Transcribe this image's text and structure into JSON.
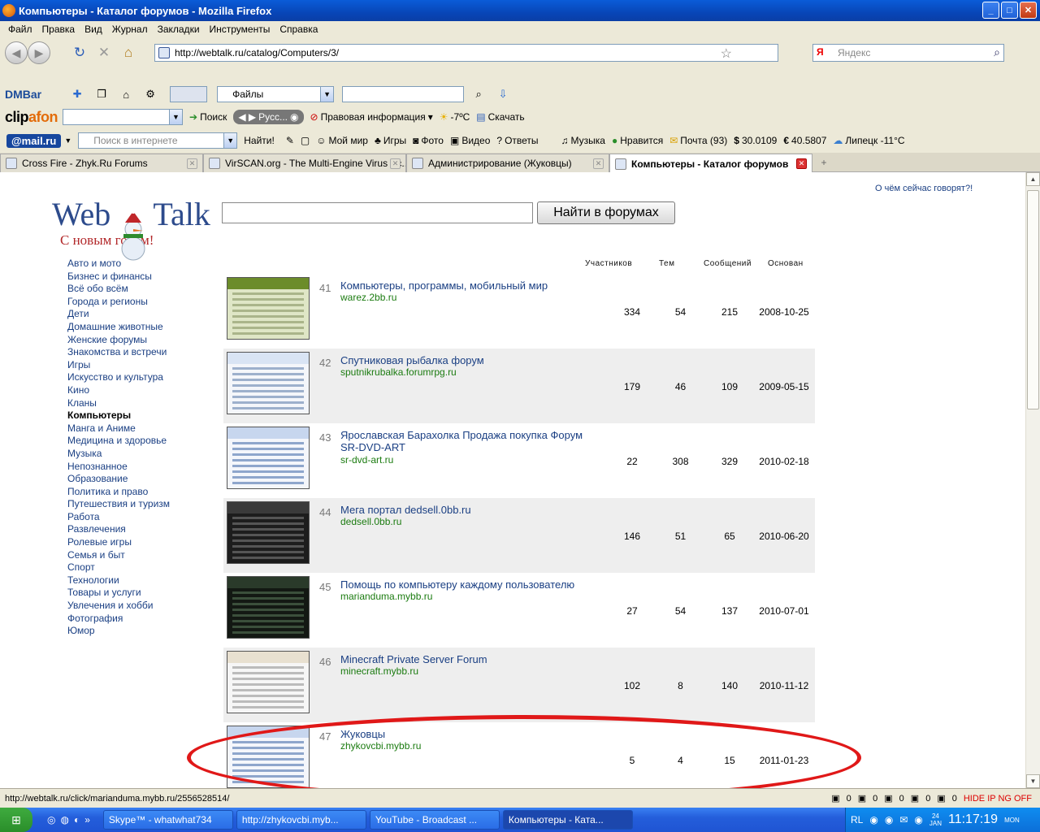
{
  "window": {
    "title": "Компьютеры - Каталог форумов - Mozilla Firefox"
  },
  "menu": [
    "Файл",
    "Правка",
    "Вид",
    "Журнал",
    "Закладки",
    "Инструменты",
    "Справка"
  ],
  "nav": {
    "url": "http://webtalk.ru/catalog/Computers/3/",
    "search_placeholder": "Яндекс",
    "search_engine_letter": "Я"
  },
  "dmbar": {
    "brand": "DMBar",
    "files_select": "Файлы"
  },
  "clipafon": {
    "brand_a": "clip",
    "brand_b": "afon",
    "search": "Поиск",
    "player_text": "Русс...",
    "legal": "Правовая информация",
    "temp": "-7ºC",
    "download": "Скачать"
  },
  "mailbar": {
    "brand": "@mail.ru",
    "search_placeholder": "Поиск в интернете",
    "find": "Найти!",
    "items": [
      "Мой мир",
      "Игры",
      "Фото",
      "Видео",
      "Ответы",
      "Музыка",
      "Нравится",
      "Почта (93)",
      "30.0109",
      "40.5807",
      "Липецк -11°C"
    ],
    "dollar": "$",
    "euro": "€"
  },
  "tabs": [
    {
      "label": "Cross Fire - Zhyk.Ru Forums",
      "active": false
    },
    {
      "label": "VirSCAN.org - The Multi-Engine Virus Sc...",
      "active": false
    },
    {
      "label": "Администрирование (Жуковцы)",
      "active": false
    },
    {
      "label": "Компьютеры - Каталог форумов",
      "active": true
    }
  ],
  "page": {
    "top_link": "О чём сейчас говорят?!",
    "logo_a": "Web",
    "logo_b": "Talk",
    "logo_sub": "С новым годом!",
    "search_button": "Найти в форумах",
    "categories": [
      "Авто и мото",
      "Бизнес и финансы",
      "Всё обо всём",
      "Города и регионы",
      "Дети",
      "Домашние животные",
      "Женские форумы",
      "Знакомства и встречи",
      "Игры",
      "Искусство и культура",
      "Кино",
      "Кланы",
      "Компьютеры",
      "Манга и Аниме",
      "Медицина и здоровье",
      "Музыка",
      "Непознанное",
      "Образование",
      "Политика и право",
      "Путешествия и туризм",
      "Работа",
      "Развлечения",
      "Ролевые игры",
      "Семья и быт",
      "Спорт",
      "Технологии",
      "Товары и услуги",
      "Увлечения и хобби",
      "Фотография",
      "Юмор"
    ],
    "selected_category": "Компьютеры",
    "columns": {
      "members": "Участников",
      "topics": "Тем",
      "messages": "Сообщений",
      "founded": "Основан"
    },
    "forums": [
      {
        "num": "41",
        "title": "Компьютеры, программы, мобильный мир",
        "url": "warez.2bb.ru",
        "members": "334",
        "topics": "54",
        "messages": "215",
        "founded": "2008-10-25"
      },
      {
        "num": "42",
        "title": "Спутниковая рыбалка форум",
        "url": "sputnikrubalka.forumrpg.ru",
        "members": "179",
        "topics": "46",
        "messages": "109",
        "founded": "2009-05-15"
      },
      {
        "num": "43",
        "title": "Ярославская Барахолка Продажа покупка Форум SR-DVD-ART",
        "url": "sr-dvd-art.ru",
        "members": "22",
        "topics": "308",
        "messages": "329",
        "founded": "2010-02-18"
      },
      {
        "num": "44",
        "title": "Мега портал dedsell.0bb.ru",
        "url": "dedsell.0bb.ru",
        "members": "146",
        "topics": "51",
        "messages": "65",
        "founded": "2010-06-20"
      },
      {
        "num": "45",
        "title": "Помощь по компьютеру каждому пользователю",
        "url": "marianduma.mybb.ru",
        "members": "27",
        "topics": "54",
        "messages": "137",
        "founded": "2010-07-01"
      },
      {
        "num": "46",
        "title": "Minecraft Private Server Forum",
        "url": "minecraft.mybb.ru",
        "members": "102",
        "topics": "8",
        "messages": "140",
        "founded": "2010-11-12"
      },
      {
        "num": "47",
        "title": "Жуковцы",
        "url": "zhykovcbi.mybb.ru",
        "members": "5",
        "topics": "4",
        "messages": "15",
        "founded": "2011-01-23"
      }
    ]
  },
  "status": {
    "text": "http://webtalk.ru/click/marianduma.mybb.ru/2556528514/",
    "counters": [
      "0",
      "0",
      "0",
      "0",
      "0"
    ],
    "hideip": "HIDE IP NG OFF"
  },
  "taskbar": {
    "tasks": [
      {
        "label": "Skype™ - whatwhat734",
        "active": false
      },
      {
        "label": "http://zhykovcbi.myb...",
        "active": false
      },
      {
        "label": "YouTube - Broadcast ...",
        "active": false
      },
      {
        "label": "Компьютеры - Ката...",
        "active": true
      }
    ],
    "lang": "RL",
    "date_day": "24",
    "date_mon": "JAN",
    "time": "11:17:19",
    "weekday": "MON"
  },
  "colors": {
    "link": "#1a3f83",
    "url_green": "#1b7b10",
    "highlight": "#e01818"
  }
}
